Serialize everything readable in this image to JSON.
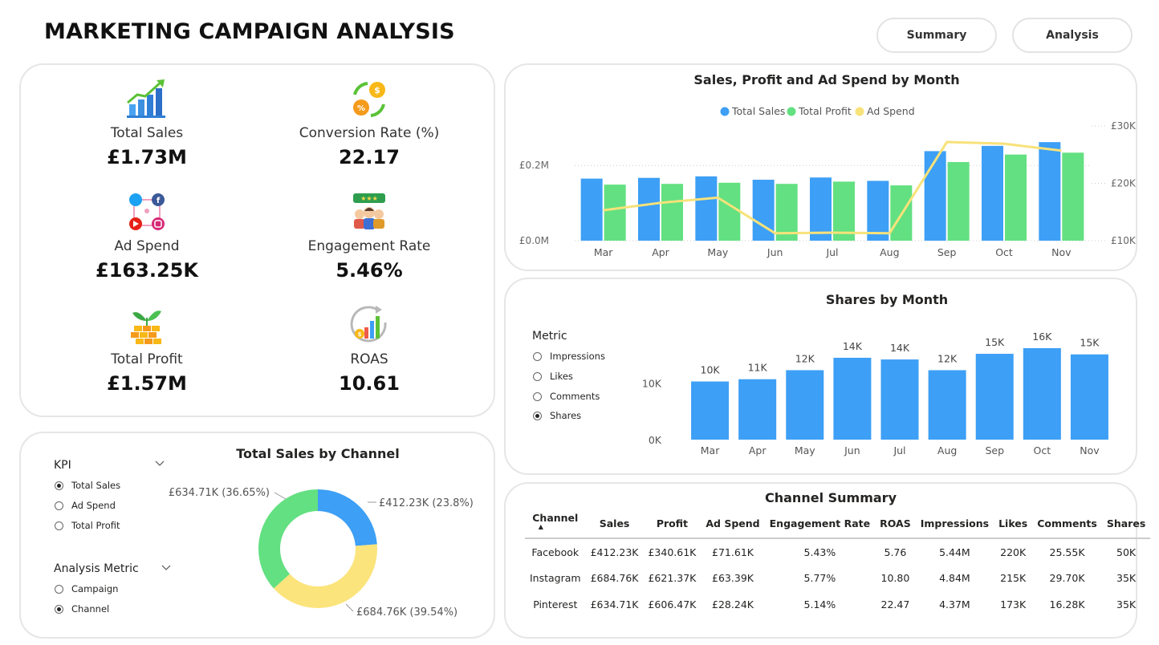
{
  "page": {
    "title": "MARKETING CAMPAIGN ANALYSIS"
  },
  "nav": {
    "summary": "Summary",
    "analysis": "Analysis"
  },
  "colors": {
    "sales": "#3d9ff5",
    "profit": "#63e081",
    "adspend": "#f8e27a",
    "donut_blue": "#3d9ff5",
    "donut_green": "#63e081",
    "donut_yellow": "#fbe47c"
  },
  "kpis": [
    {
      "label": "Total Sales",
      "value": "£1.73M",
      "icon": "growth-chart-icon"
    },
    {
      "label": "Conversion Rate (%)",
      "value": "22.17",
      "icon": "conversion-cycle-icon"
    },
    {
      "label": "Ad Spend",
      "value": "£163.25K",
      "icon": "social-media-icon"
    },
    {
      "label": "Engagement Rate",
      "value": "5.46%",
      "icon": "audience-rating-icon"
    },
    {
      "label": "Total Profit",
      "value": "£1.57M",
      "icon": "money-plant-icon"
    },
    {
      "label": "ROAS",
      "value": "10.61",
      "icon": "return-chart-icon"
    }
  ],
  "channel_slicers": {
    "kpi_title": "KPI",
    "kpi_options": [
      "Total Sales",
      "Ad Spend",
      "Total Profit"
    ],
    "kpi_selected": "Total Sales",
    "metric_title": "Analysis Metric",
    "metric_options": [
      "Campaign",
      "Channel"
    ],
    "metric_selected": "Channel"
  },
  "shares_slicer": {
    "title": "Metric",
    "options": [
      "Impressions",
      "Likes",
      "Comments",
      "Shares"
    ],
    "selected": "Shares"
  },
  "chart_data": [
    {
      "type": "bar",
      "title": "Sales, Profit and Ad Spend by Month",
      "categories": [
        "Mar",
        "Apr",
        "May",
        "Jun",
        "Jul",
        "Aug",
        "Sep",
        "Oct",
        "Nov"
      ],
      "series": [
        {
          "name": "Total Sales",
          "values": [
            0.165,
            0.167,
            0.171,
            0.162,
            0.168,
            0.159,
            0.238,
            0.252,
            0.262
          ],
          "axis": "left"
        },
        {
          "name": "Total Profit",
          "values": [
            0.149,
            0.151,
            0.154,
            0.151,
            0.157,
            0.147,
            0.209,
            0.229,
            0.234
          ],
          "axis": "left"
        },
        {
          "name": "Ad Spend",
          "values": [
            15300,
            16600,
            17500,
            11300,
            11400,
            11300,
            27200,
            26900,
            25700
          ],
          "axis": "right",
          "style": "line"
        }
      ],
      "yticks_left": [
        "£0.0M",
        "£0.2M"
      ],
      "ylim_left": [
        0,
        0.305
      ],
      "yticks_right": [
        "£10K",
        "£20K",
        "£30K"
      ],
      "ylim_right": [
        10000,
        30000
      ],
      "legend": "top-center"
    },
    {
      "type": "bar",
      "title": "Shares by Month",
      "categories": [
        "Mar",
        "Apr",
        "May",
        "Jun",
        "Jul",
        "Aug",
        "Sep",
        "Oct",
        "Nov"
      ],
      "values": [
        10300,
        10700,
        12300,
        14500,
        14200,
        12300,
        15200,
        16200,
        15100
      ],
      "data_labels": [
        "10K",
        "11K",
        "12K",
        "14K",
        "14K",
        "12K",
        "15K",
        "16K",
        "15K"
      ],
      "yticks": [
        "0K",
        "10K"
      ],
      "ylim": [
        0,
        16200
      ]
    },
    {
      "type": "pie",
      "title": "Total Sales by Channel",
      "slices": [
        {
          "label": "£412.23K (23.8%)",
          "value": 23.8,
          "color": "#3d9ff5"
        },
        {
          "label": "£684.76K (39.54%)",
          "value": 39.54,
          "color": "#fbe47c"
        },
        {
          "label": "£634.71K (36.65%)",
          "value": 36.65,
          "color": "#63e081"
        }
      ]
    }
  ],
  "summary_table": {
    "title": "Channel Summary",
    "columns": [
      "Channel",
      "Sales",
      "Profit",
      "Ad Spend",
      "Engagement Rate",
      "ROAS",
      "Impressions",
      "Likes",
      "Comments",
      "Shares"
    ],
    "rows": [
      [
        "Facebook",
        "£412.23K",
        "£340.61K",
        "£71.61K",
        "5.43%",
        "5.76",
        "5.44M",
        "220K",
        "25.55K",
        "50K"
      ],
      [
        "Instagram",
        "£684.76K",
        "£621.37K",
        "£63.39K",
        "5.77%",
        "10.80",
        "4.84M",
        "215K",
        "29.70K",
        "35K"
      ],
      [
        "Pinterest",
        "£634.71K",
        "£606.47K",
        "£28.24K",
        "5.14%",
        "22.47",
        "4.37M",
        "173K",
        "16.28K",
        "35K"
      ]
    ]
  }
}
